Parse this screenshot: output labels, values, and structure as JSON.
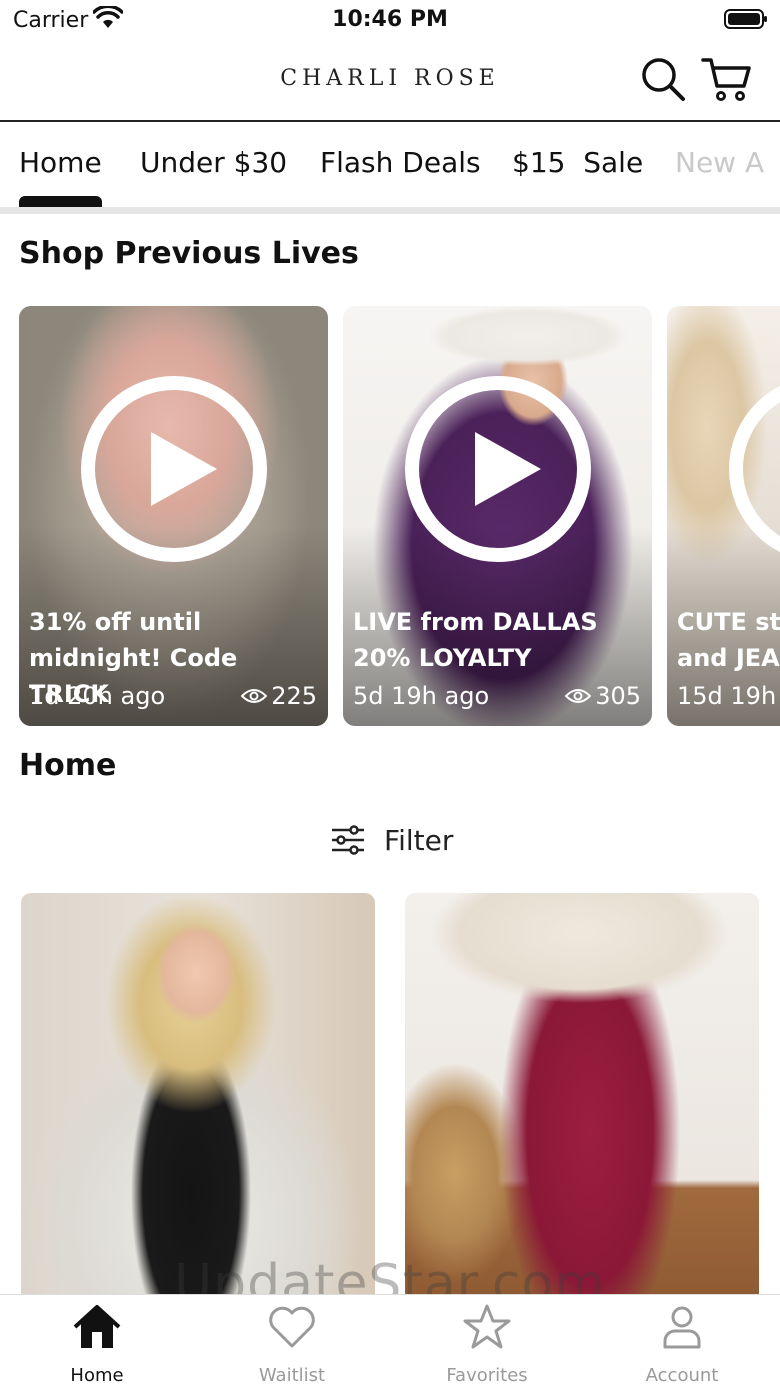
{
  "status_bar": {
    "carrier": "Carrier",
    "time": "10:46 PM"
  },
  "header": {
    "brand": "CHARLI ROSE",
    "search_icon": "search-icon",
    "cart_icon": "cart-icon"
  },
  "tabs": [
    {
      "label": "Home",
      "active": true
    },
    {
      "label": "Under $30"
    },
    {
      "label": "Flash Deals"
    },
    {
      "label": "$15  Sale"
    },
    {
      "label": "New A"
    }
  ],
  "lives": {
    "title": "Shop Previous Lives",
    "items": [
      {
        "title": "31% off until\nmidnight! Code TRICK",
        "age": "1d 20h ago",
        "views": "225"
      },
      {
        "title": "LIVE from DALLAS\n20% LOYALTY",
        "age": "5d 19h ago",
        "views": "305"
      },
      {
        "title": "CUTE stu\nand JEA",
        "age": "15d 19h",
        "views": ""
      }
    ]
  },
  "home": {
    "title": "Home",
    "filter_label": "Filter"
  },
  "watermark": "UpdateStar.com",
  "bottom_nav": [
    {
      "label": "Home",
      "icon": "home-icon",
      "active": true
    },
    {
      "label": "Waitlist",
      "icon": "heart-icon"
    },
    {
      "label": "Favorites",
      "icon": "star-icon"
    },
    {
      "label": "Account",
      "icon": "person-icon"
    }
  ],
  "colors": {
    "accent": "#111111",
    "inactive": "#9a9a9a",
    "divider": "#e6e6e6"
  }
}
